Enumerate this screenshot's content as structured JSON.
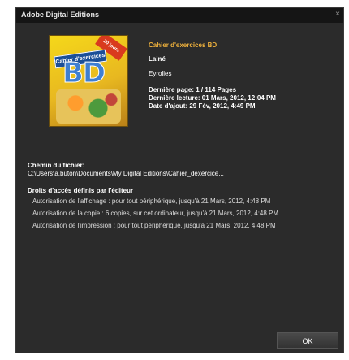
{
  "window": {
    "title": "Adobe Digital Editions",
    "close_glyph": "×"
  },
  "cover": {
    "badge": "20 jours",
    "banner": "Cahier d'exercices",
    "letters": "BD"
  },
  "book": {
    "title": "Cahier d'exercices BD",
    "author": "Lainé",
    "publisher": "Eyrolles",
    "last_page": "Dernière page: 1 / 114 Pages",
    "last_read": "Dernière lecture: 01 Mars, 2012, 12:04 PM",
    "date_added": "Date d'ajout: 29 Fév, 2012, 4:49 PM"
  },
  "path": {
    "label": "Chemin du fichier:",
    "value": "C:\\Users\\a.buton\\Documents\\My Digital Editions\\Cahier_dexercice..."
  },
  "rights": {
    "label": "Droits d'accès définis par l'éditeur",
    "items": [
      "Autorisation de l'affichage : pour tout périphérique, jusqu'à 21 Mars, 2012, 4:48 PM",
      "Autorisation de la copie : 6 copies, sur cet ordinateur, jusqu'à 21 Mars, 2012, 4:48 PM",
      "Autorisation de l'impression : pour tout périphérique, jusqu'à 21 Mars, 2012, 4:48 PM"
    ]
  },
  "buttons": {
    "ok": "OK"
  }
}
